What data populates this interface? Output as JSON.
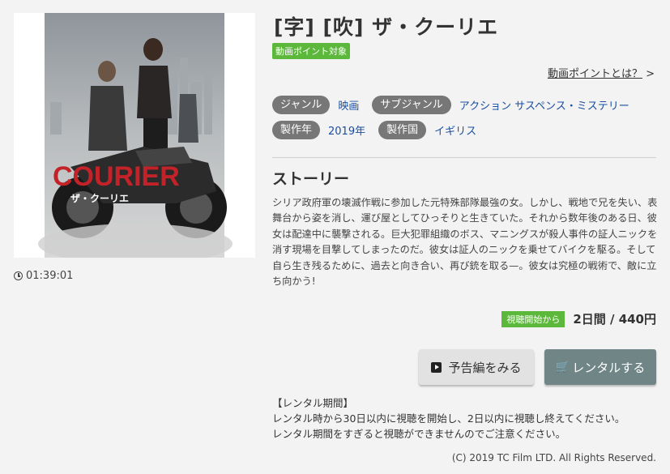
{
  "duration": "01:39:01",
  "poster": {
    "title_latin": "COURIER",
    "title_jp": "ザ・クーリエ"
  },
  "title": "[字] [吹] ザ・クーリエ",
  "badge_points": "動画ポイント対象",
  "points_link": {
    "label": "動画ポイントとは？",
    "arrow": ">"
  },
  "meta": {
    "genre_label": "ジャンル",
    "genre_value": "映画",
    "subgenre_label": "サブジャンル",
    "subgenre_value": "アクション サスペンス・ミステリー",
    "year_label": "製作年",
    "year_value": "2019年",
    "country_label": "製作国",
    "country_value": "イギリス"
  },
  "story": {
    "heading": "ストーリー",
    "text": "シリア政府軍の壊滅作戦に参加した元特殊部隊最強の女。しかし、戦地で兄を失い、表舞台から姿を消し、運び屋としてひっそりと生きていた。それから数年後のある日、彼女は配達中に襲撃される。巨大犯罪組織のボス、マニングスが殺人事件の証人ニックを消す現場を目撃してしまったのだ。彼女は証人のニックを乗せてバイクを駆る。そして自ら生き残るために、過去と向き合い、再び銃を取る—。彼女は究極の戦術で、敵に立ち向かう!"
  },
  "price": {
    "badge": "視聴開始から",
    "value": "2日間 / 440円"
  },
  "buttons": {
    "trailer": "予告編をみる",
    "rent": "レンタルする"
  },
  "rental_info": {
    "heading": "【レンタル期間】",
    "line1": "レンタル時から30日以内に視聴を開始し、2日以内に視聴し終えてください。",
    "line2": "レンタル期間をすぎると視聴ができませんのでご注意ください。"
  },
  "copyright": "(C) 2019 TC Film LTD. All Rights Reserved.",
  "colors": {
    "green": "#5bb83a",
    "pill": "#777777",
    "link": "#1a4fa0",
    "rent": "#6f8586"
  }
}
